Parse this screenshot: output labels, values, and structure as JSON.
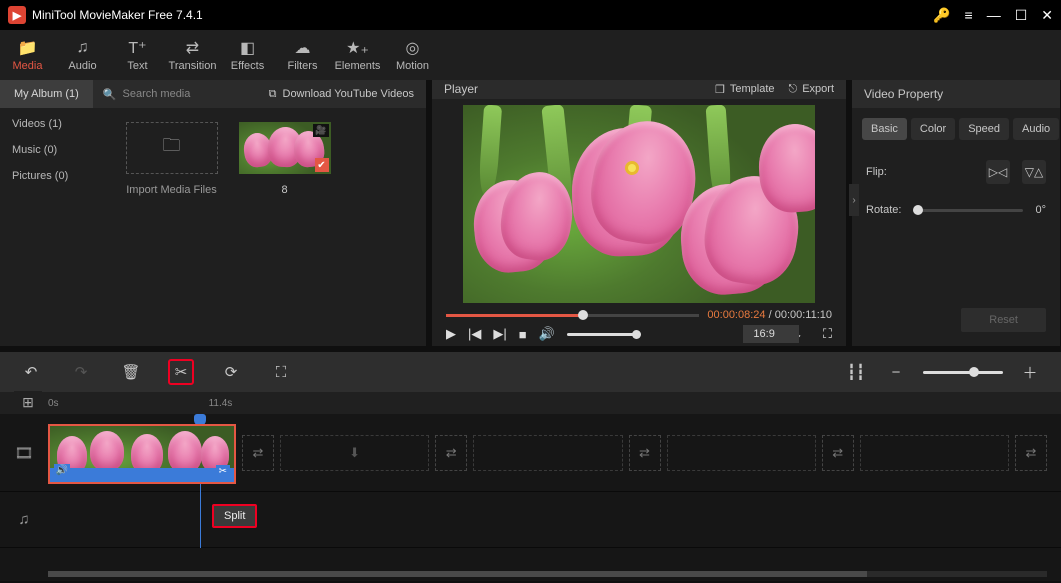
{
  "titlebar": {
    "title": "MiniTool MovieMaker Free 7.4.1"
  },
  "toolbar": [
    {
      "key": "media",
      "label": "Media",
      "active": true
    },
    {
      "key": "audio",
      "label": "Audio"
    },
    {
      "key": "text",
      "label": "Text"
    },
    {
      "key": "transition",
      "label": "Transition"
    },
    {
      "key": "effects",
      "label": "Effects"
    },
    {
      "key": "filters",
      "label": "Filters"
    },
    {
      "key": "elements",
      "label": "Elements"
    },
    {
      "key": "motion",
      "label": "Motion"
    }
  ],
  "album": {
    "tab": "My Album (1)",
    "search_placeholder": "Search media",
    "download_label": "Download YouTube Videos",
    "side": {
      "videos": "Videos (1)",
      "music": "Music (0)",
      "pictures": "Pictures (0)"
    },
    "import_label": "Import Media Files",
    "item_badge": "8"
  },
  "player": {
    "title": "Player",
    "template_label": "Template",
    "export_label": "Export",
    "current_time": "00:00:08:24",
    "total_time": "00:00:11:10",
    "progress_pct": 54,
    "ratio": "16:9"
  },
  "property": {
    "title": "Video Property",
    "tabs": [
      "Basic",
      "Color",
      "Speed",
      "Audio"
    ],
    "active_tab": 0,
    "flip_label": "Flip:",
    "rotate_label": "Rotate:",
    "rotate_value": "0°",
    "reset_label": "Reset"
  },
  "timeline": {
    "ruler": {
      "t0": "0s",
      "t1": "11.4s"
    },
    "tooltip": "Split",
    "playhead_pct": 54
  },
  "colors": {
    "accent": "#e45744",
    "highlight_border": "#e02020"
  }
}
